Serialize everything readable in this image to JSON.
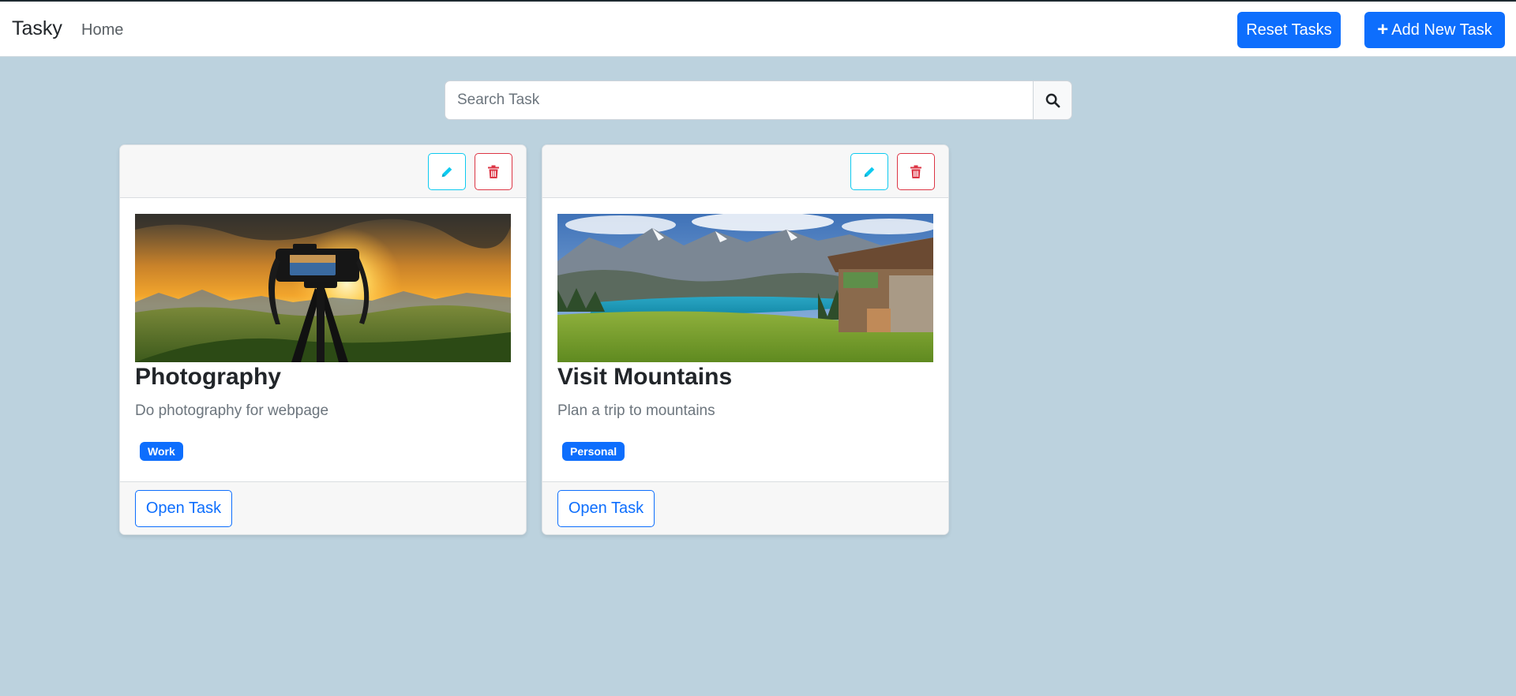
{
  "navbar": {
    "brand": "Tasky",
    "home_label": "Home",
    "reset_label": "Reset Tasks",
    "add_label": "Add New Task",
    "add_icon": "plus-icon"
  },
  "search": {
    "placeholder": "Search Task",
    "value": "",
    "icon": "search-icon"
  },
  "colors": {
    "background": "#bcd2de",
    "primary": "#0d6efd",
    "edit_outline": "#0dcaf0",
    "delete_outline": "#dc3545"
  },
  "tasks": [
    {
      "title": "Photography",
      "description": "Do photography for webpage",
      "type": "Work",
      "open_label": "Open Task",
      "image": "camera-on-tripod-at-sunset-photo"
    },
    {
      "title": "Visit Mountains",
      "description": "Plan a trip to mountains",
      "type": "Personal",
      "open_label": "Open Task",
      "image": "mountain-lake-with-cabin-photo"
    }
  ]
}
